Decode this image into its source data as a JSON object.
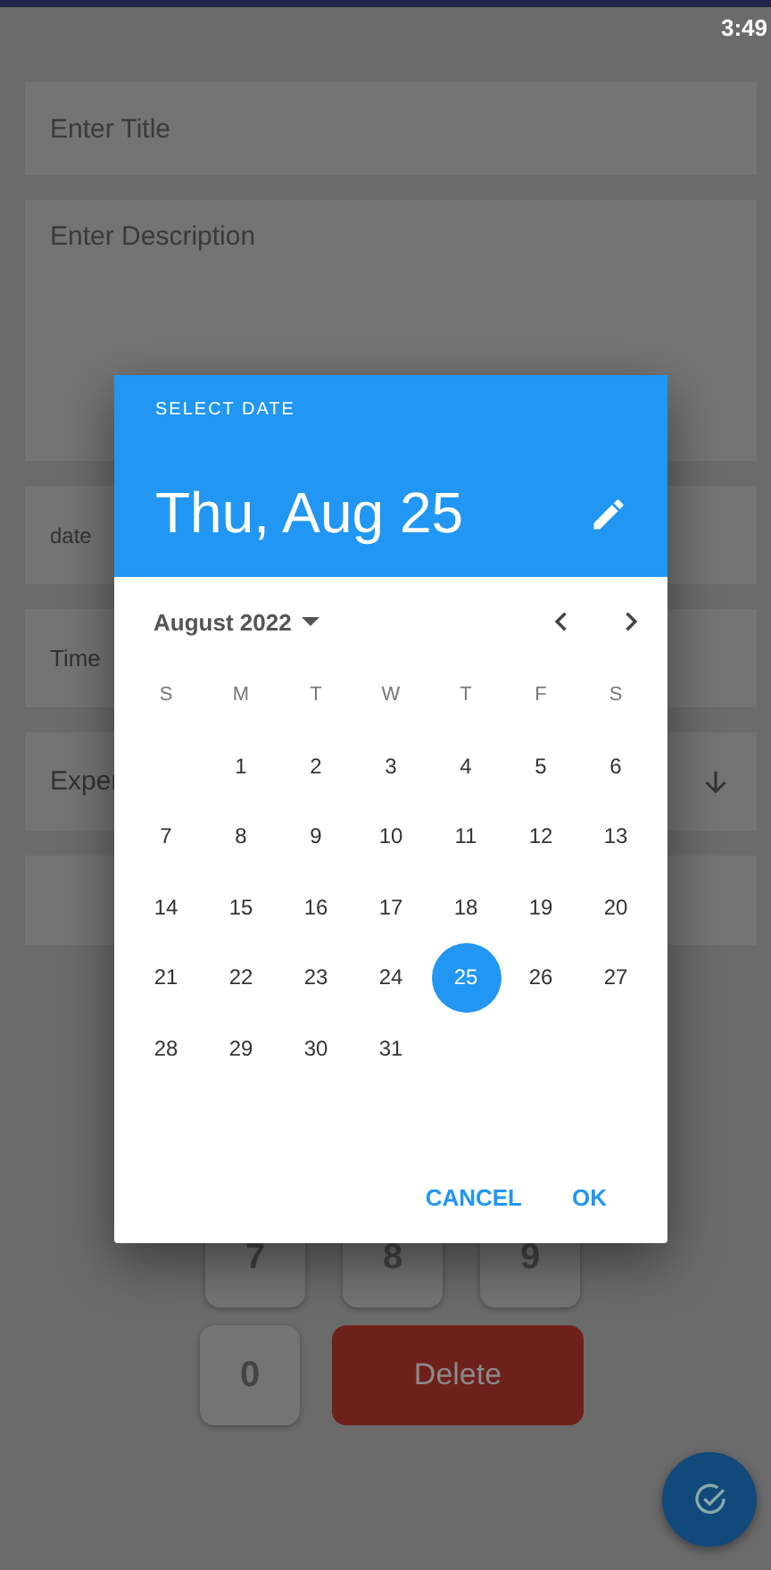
{
  "status_bar": {
    "time": "3:49"
  },
  "form": {
    "title_field": {
      "placeholder": "Enter Title"
    },
    "description_field": {
      "placeholder": "Enter Description"
    },
    "date_field": {
      "label": "date"
    },
    "time_field": {
      "label": "Time"
    },
    "type_field": {
      "value": "Exper"
    }
  },
  "keypad": {
    "keys": [
      "7",
      "8",
      "9",
      "0"
    ],
    "delete": "Delete"
  },
  "date_dialog": {
    "overline": "SELECT DATE",
    "headline": "Thu, Aug 25",
    "month": "August 2022",
    "weekdays": [
      "S",
      "M",
      "T",
      "W",
      "T",
      "F",
      "S"
    ],
    "weeks": [
      [
        {
          "day": "1",
          "selected": false
        },
        {
          "day": "2",
          "selected": false
        },
        {
          "day": "3",
          "selected": false
        },
        {
          "day": "4",
          "selected": false
        },
        {
          "day": "5",
          "selected": false
        },
        {
          "day": "6",
          "selected": false
        }
      ],
      [
        {
          "day": "7",
          "selected": false
        },
        {
          "day": "8",
          "selected": false
        },
        {
          "day": "9",
          "selected": false
        },
        {
          "day": "10",
          "selected": false
        },
        {
          "day": "11",
          "selected": false
        },
        {
          "day": "12",
          "selected": false
        },
        {
          "day": "13",
          "selected": false
        }
      ],
      [
        {
          "day": "14",
          "selected": false
        },
        {
          "day": "15",
          "selected": false
        },
        {
          "day": "16",
          "selected": false
        },
        {
          "day": "17",
          "selected": false
        },
        {
          "day": "18",
          "selected": false
        },
        {
          "day": "19",
          "selected": false
        },
        {
          "day": "20",
          "selected": false
        }
      ],
      [
        {
          "day": "21",
          "selected": false
        },
        {
          "day": "22",
          "selected": false
        },
        {
          "day": "23",
          "selected": false
        },
        {
          "day": "24",
          "selected": false
        },
        {
          "day": "25",
          "selected": true
        },
        {
          "day": "26",
          "selected": false
        },
        {
          "day": "27",
          "selected": false
        }
      ],
      [
        {
          "day": "28",
          "selected": false
        },
        {
          "day": "29",
          "selected": false
        },
        {
          "day": "30",
          "selected": false
        },
        {
          "day": "31",
          "selected": false
        }
      ]
    ],
    "buttons": [
      "CANCEL",
      "OK"
    ]
  }
}
